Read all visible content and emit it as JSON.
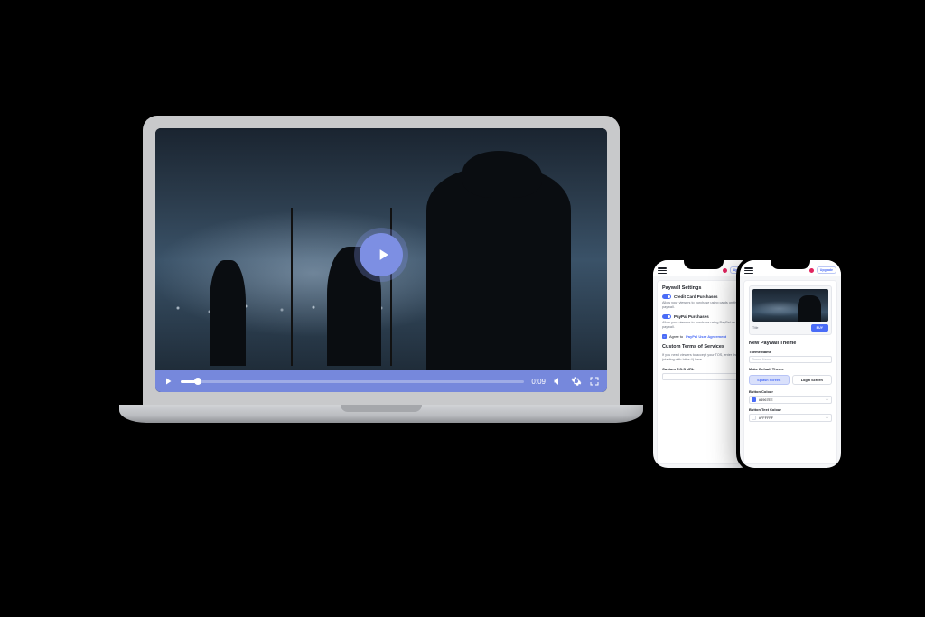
{
  "laptop": {
    "play_tooltip": "Play",
    "time_display": "0:09"
  },
  "phone1": {
    "header": {
      "upgrade_label": "Upgrade"
    },
    "paywall": {
      "title": "Paywall Settings",
      "credit_card_label": "Credit Card Purchases",
      "credit_card_help": "Allow your viewers to purchase using cards on the paywall.",
      "paypal_label": "PayPal Purchases",
      "paypal_help": "Allow your viewers to purchase using PayPal on the paywall.",
      "agree_prefix": "Agree to ",
      "agree_link": "PayPal User Agreement"
    },
    "tos": {
      "title": "Custom Terms of Services",
      "help": "If you need viewers to accept your TOS, enter the URL (starting with https://) here.",
      "url_label": "Custom T.O.S URL"
    }
  },
  "phone2": {
    "header": {
      "upgrade_label": "Upgrade"
    },
    "preview": {
      "title_label": "Title",
      "buy_label": "BUY"
    },
    "theme": {
      "title": "New Paywall Theme",
      "name_label": "Theme Name",
      "name_placeholder": "Theme Name",
      "make_default_label": "Make Default Theme",
      "tab_splash": "Splash Screen",
      "tab_login": "Login Screen",
      "button_color_label": "Button Colour",
      "button_color_value": "#4967EE",
      "button_text_color_label": "Button Text Colour",
      "button_text_color_value": "#FFFFFF"
    }
  }
}
